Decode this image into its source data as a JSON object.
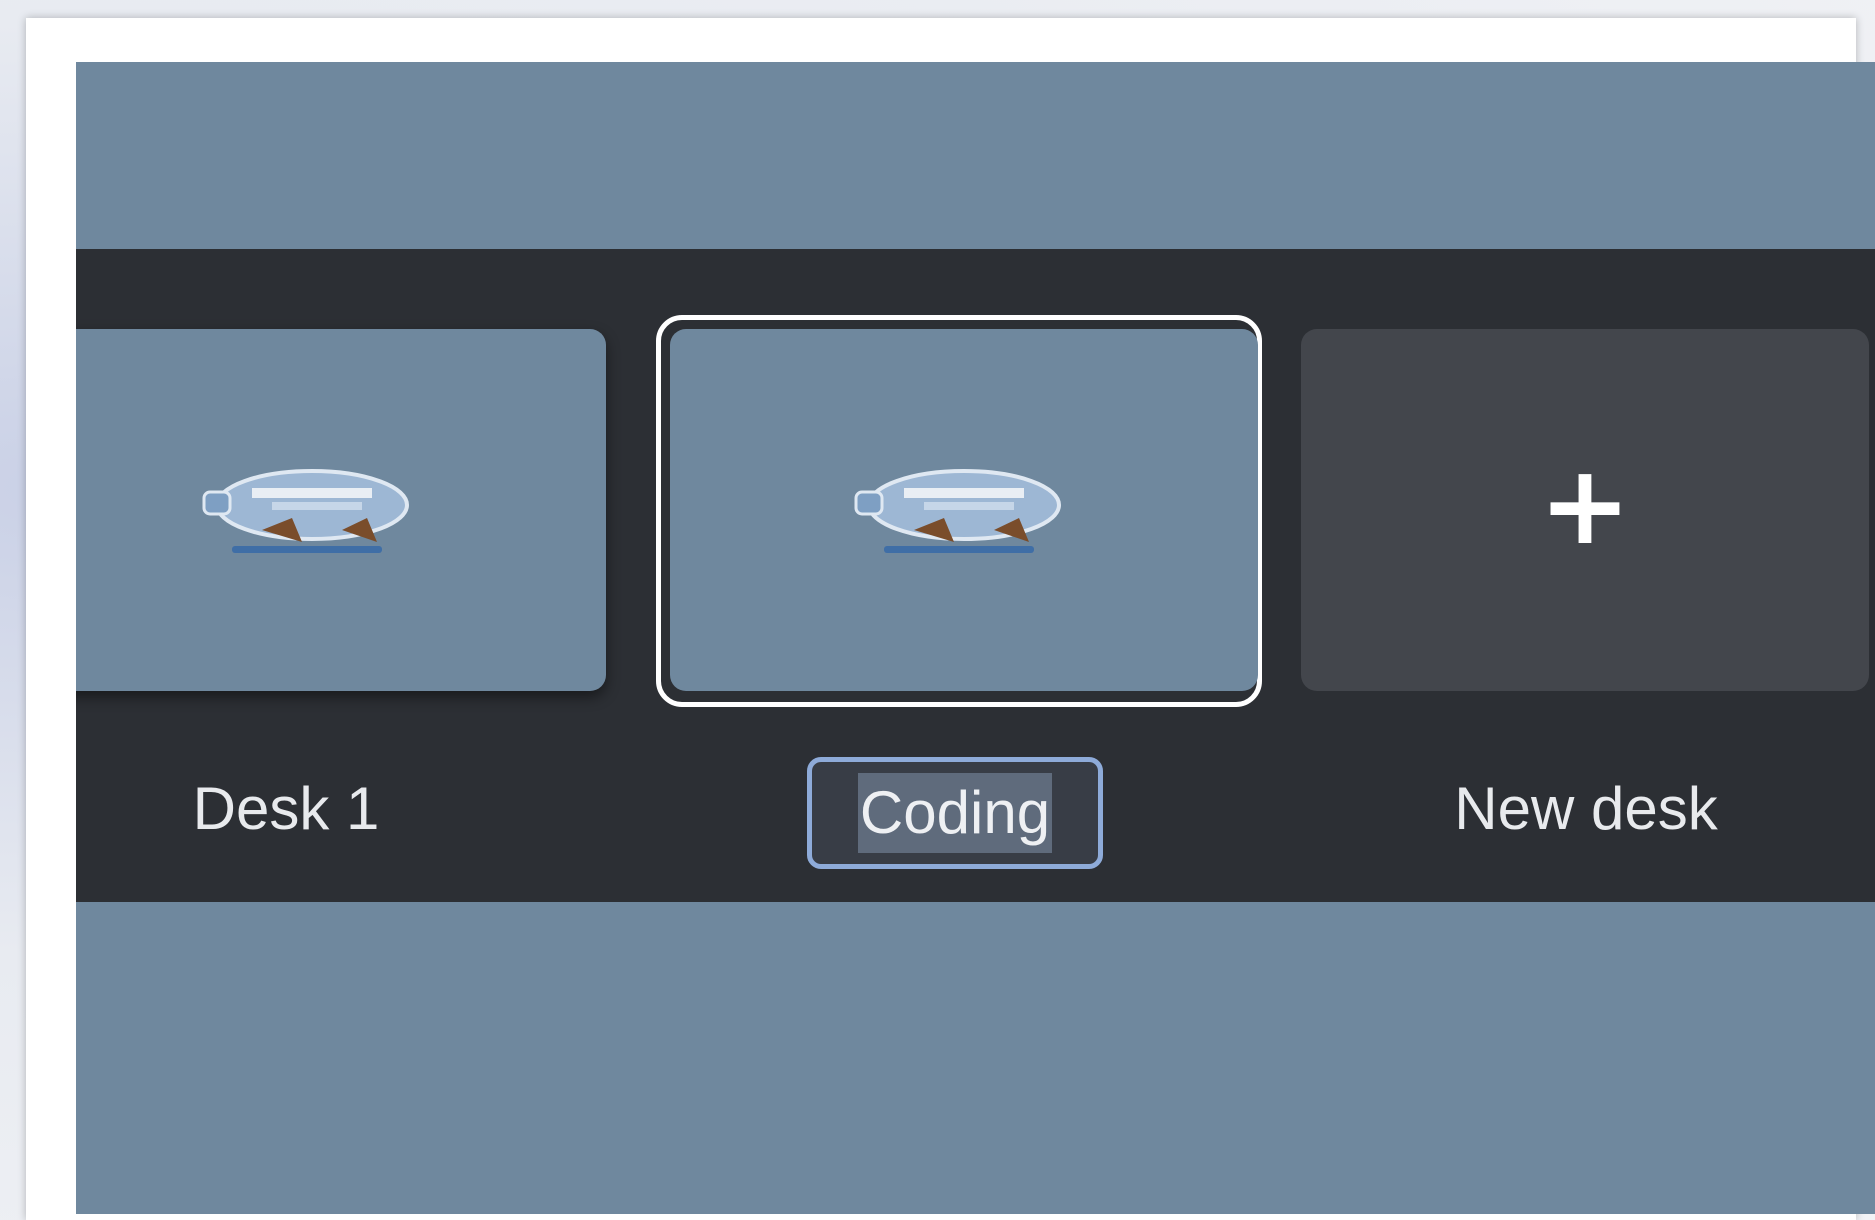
{
  "desks": [
    {
      "label": "Desk 1",
      "active": false
    },
    {
      "label": "Coding",
      "active": true,
      "editing": true
    },
    {
      "label": "New desk",
      "icon": "plus-icon"
    }
  ],
  "new_desk_symbol": "+",
  "colors": {
    "wallpaper": "#6f889e",
    "desk_bar": "#2c2f34",
    "new_desk_tile": "#43464c",
    "active_ring": "#ffffff",
    "name_field_focus": "#8eabd9"
  },
  "icons": {
    "wallpaper": "bottle-ship-icon"
  }
}
